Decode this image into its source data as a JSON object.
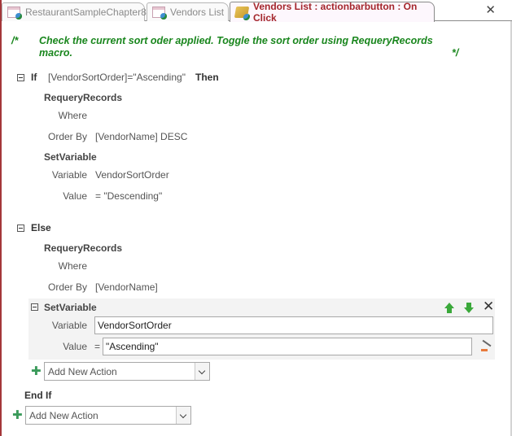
{
  "tabs": [
    {
      "label": "RestaurantSampleChapter8",
      "icon": "form-icon",
      "active": false
    },
    {
      "label": "Vendors List",
      "icon": "form-icon",
      "active": false
    },
    {
      "label": "Vendors List : actionbarbutton : On Click",
      "icon": "macro-icon",
      "active": true
    }
  ],
  "tab_close": "✕",
  "comment": {
    "open": "/*",
    "text": "Check the current sort oder applied. Toggle the sort order using RequeryRecords macro.",
    "close": "*/"
  },
  "if_block": {
    "keyword": "If",
    "condition": "[VendorSortOrder]=\"Ascending\"",
    "then": "Then",
    "actions": [
      {
        "name": "RequeryRecords",
        "args": [
          {
            "label": "Where",
            "value": ""
          },
          {
            "label": "Order By",
            "value": "[VendorName] DESC"
          }
        ]
      },
      {
        "name": "SetVariable",
        "args": [
          {
            "label": "Variable",
            "value": "VendorSortOrder"
          },
          {
            "label": "Value",
            "value": "= \"Descending\""
          }
        ]
      }
    ]
  },
  "else_block": {
    "keyword": "Else",
    "actions": [
      {
        "name": "RequeryRecords",
        "args": [
          {
            "label": "Where",
            "value": ""
          },
          {
            "label": "Order By",
            "value": "[VendorName]"
          }
        ]
      },
      {
        "name": "SetVariable",
        "selected": true,
        "args": [
          {
            "label": "Variable",
            "value": "VendorSortOrder"
          },
          {
            "label": "Value",
            "eq": "=",
            "value": "\"Ascending\""
          }
        ]
      }
    ],
    "add_action_placeholder": "Add New Action"
  },
  "end_if": "End If",
  "add_action_placeholder": "Add New Action",
  "colors": {
    "comment": "#19861d",
    "active_tab_text": "#a4262c",
    "left_border": "#a4373a",
    "move_arrows": "#3aa83a"
  }
}
